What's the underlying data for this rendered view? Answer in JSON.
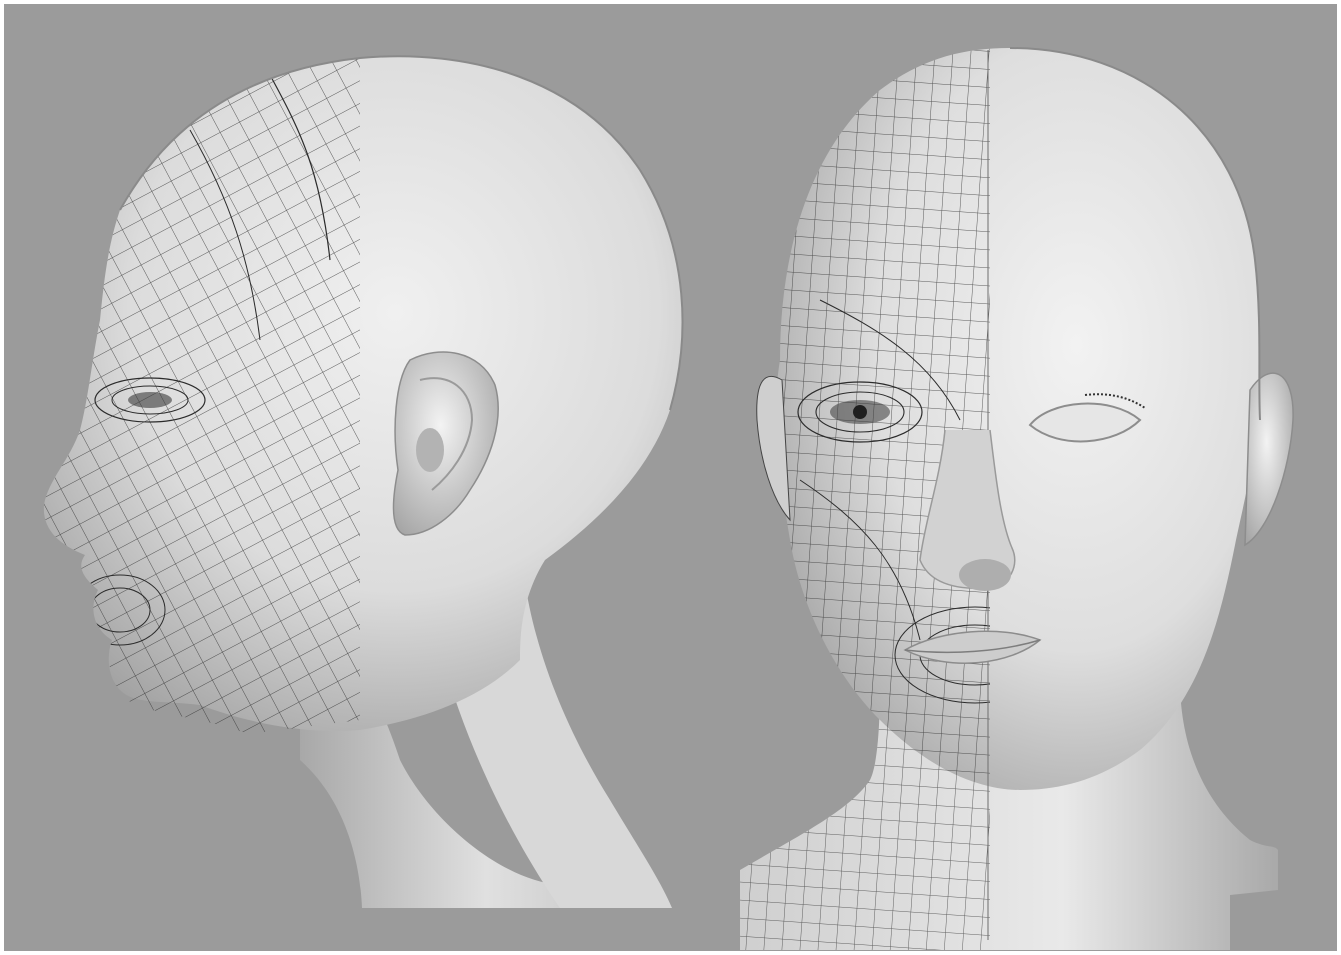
{
  "colors": {
    "frame": "#ffffff",
    "background": "#9b9b9b",
    "skin_light": "#ececec",
    "skin_mid": "#cfcfcf",
    "skin_dark": "#8c8c8c",
    "wire": "#2b2b2b"
  },
  "scene": {
    "left_view": "profile",
    "right_view": "front"
  }
}
